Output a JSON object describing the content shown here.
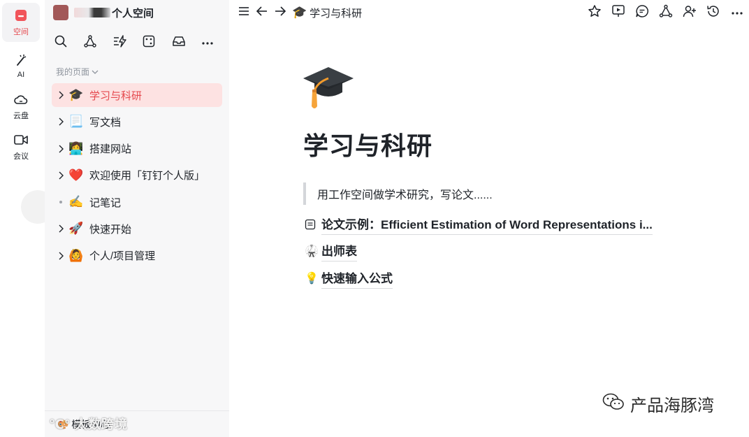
{
  "rail": {
    "items": [
      {
        "label": "空间",
        "icon": "space-icon",
        "active": true
      },
      {
        "label": "AI",
        "icon": "magic-wand-icon",
        "active": false
      },
      {
        "label": "云盘",
        "icon": "cloud-icon",
        "active": false
      },
      {
        "label": "会议",
        "icon": "video-camera-icon",
        "active": false
      }
    ]
  },
  "sidebar": {
    "workspace_name": "个人空间",
    "tools": [
      "search-icon",
      "graph-icon",
      "quick-action-icon",
      "dice-icon",
      "inbox-icon",
      "more-icon"
    ],
    "section_label": "我的页面",
    "tree": [
      {
        "emoji": "🎓",
        "label": "学习与科研",
        "expandable": true,
        "selected": true
      },
      {
        "emoji": "📃",
        "label": "写文档",
        "expandable": true,
        "selected": false
      },
      {
        "emoji": "👩‍💻",
        "label": "搭建网站",
        "expandable": true,
        "selected": false
      },
      {
        "emoji": "❤️",
        "label": "欢迎使用「钉钉个人版」",
        "expandable": true,
        "selected": false
      },
      {
        "emoji": "✍️",
        "label": "记笔记",
        "expandable": false,
        "selected": false
      },
      {
        "emoji": "🚀",
        "label": "快速开始",
        "expandable": true,
        "selected": false
      },
      {
        "emoji": "🙆",
        "label": "个人/项目管理",
        "expandable": true,
        "selected": false
      }
    ],
    "footer_label": "模板中心",
    "watermark": "大数跨境"
  },
  "topbar": {
    "title_emoji": "🎓",
    "title": "学习与科研",
    "right_icons": [
      "star-icon",
      "present-icon",
      "comment-icon",
      "graph-icon",
      "add-member-icon",
      "history-icon",
      "more-icon"
    ]
  },
  "page": {
    "title": "学习与科研",
    "quote": "用工作空间做学术研究，写论文......",
    "links": [
      {
        "icon": "document-icon",
        "text": "论文示例：Efficient Estimation of Word Representations i..."
      },
      {
        "icon": "martial-arts-icon",
        "text": "出师表"
      },
      {
        "icon": "light-bulb-icon",
        "text": "快速输入公式"
      }
    ]
  },
  "watermark": "产品海豚湾",
  "colors": {
    "accent": "#e5484d",
    "selected_bg": "#fde2e2",
    "sidebar_bg": "#f7f7f8"
  }
}
